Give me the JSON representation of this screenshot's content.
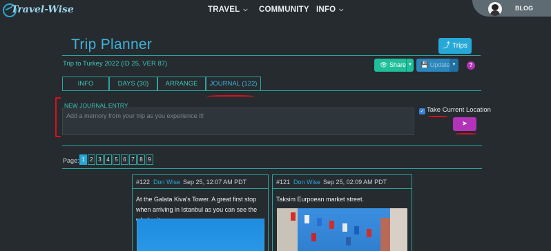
{
  "nav": {
    "logo_text": "Travel-Wise",
    "items": [
      {
        "label": "TRAVEL",
        "has_dropdown": true
      },
      {
        "label": "COMMUNITY",
        "has_dropdown": false
      },
      {
        "label": "INFO",
        "has_dropdown": true
      }
    ],
    "blog_label": "BLOG"
  },
  "header": {
    "title": "Trip Planner",
    "trips_button": "Trips",
    "subtitle": "Trip to Turkey 2022 (ID 25, VER 87)",
    "share_button": "Share",
    "update_button": "Update",
    "help_label": "?"
  },
  "tabs": [
    {
      "label": "INFO"
    },
    {
      "label": "DAYS (30)"
    },
    {
      "label": "ARRANGE"
    },
    {
      "label": "JOURNAL (122)",
      "active": true
    }
  ],
  "journal": {
    "section_label": "NEW JOURNAL ENTRY",
    "placeholder": "Add a memory from your trip as you experience it!",
    "location_label": "Take Current Location",
    "location_checked": true,
    "send_icon": "paper-plane-icon"
  },
  "pagination": {
    "label": "Page:",
    "pages": [
      "1",
      "2",
      "3",
      "4",
      "5",
      "6",
      "7",
      "8",
      "9"
    ],
    "current": "1"
  },
  "posts": [
    {
      "id": "#122",
      "author": "Don Wise",
      "time": "Sep 25, 12:07 AM PDT",
      "text": "At the Galata Kiva's Tower. A great first stop when arriving in Istanbul as you can see the whole city."
    },
    {
      "id": "#121",
      "author": "Don Wise",
      "time": "Sep 25, 02:09 AM PDT",
      "text": "Taksim Eurpoean market street."
    }
  ],
  "colors": {
    "background": "#262b30",
    "accent_teal": "#2aa5a0",
    "accent_blue": "#27a9d8",
    "accent_purple": "#b233b8",
    "annotation_red": "#d8121b"
  }
}
